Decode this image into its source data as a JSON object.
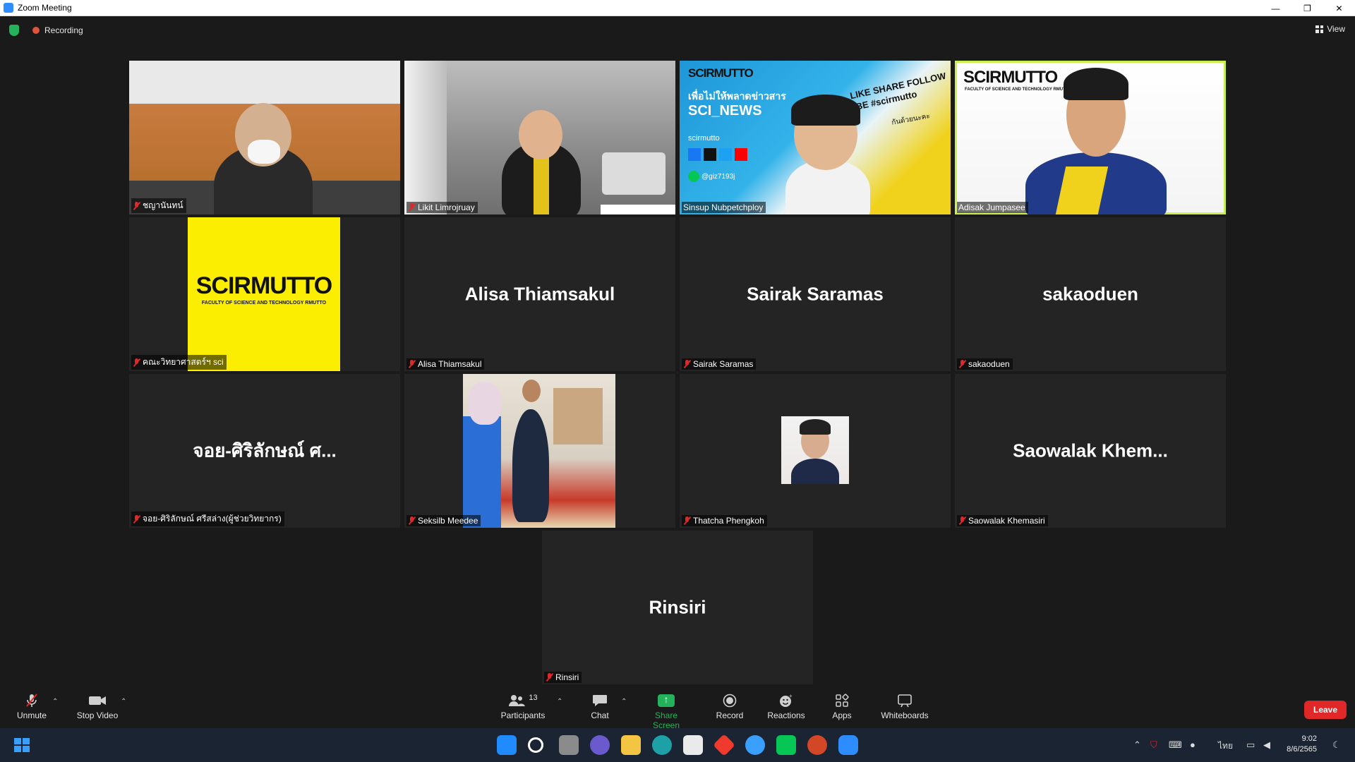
{
  "window": {
    "title": "Zoom Meeting",
    "controls": {
      "minimize": "—",
      "restore": "❐",
      "close": "✕"
    }
  },
  "topbar": {
    "recording_label": "Recording",
    "view_label": "View"
  },
  "participants": [
    {
      "name": "ชญานันทน์",
      "muted": true,
      "type": "video"
    },
    {
      "name": "Likit Limrojruay",
      "muted": true,
      "type": "video"
    },
    {
      "name": "Sinsup Nubpetchploy",
      "muted": false,
      "type": "video"
    },
    {
      "name": "Adisak Jumpasee",
      "muted": false,
      "type": "video",
      "active_speaker": true
    },
    {
      "name": "คณะวิทยาศาสตร์ฯ sci",
      "muted": true,
      "type": "image"
    },
    {
      "name": "Alisa Thiamsakul",
      "display": "Alisa Thiamsakul",
      "muted": true,
      "type": "name"
    },
    {
      "name": "Sairak Saramas",
      "display": "Sairak Saramas",
      "muted": true,
      "type": "name"
    },
    {
      "name": "sakaoduen",
      "display": "sakaoduen",
      "muted": true,
      "type": "name"
    },
    {
      "name": "จอย-ศิริลักษณ์ ศรีสล่าง(ผู้ช่วยวิทยากร)",
      "display": "จอย-ศิริลักษณ์ ศ...",
      "muted": true,
      "type": "name"
    },
    {
      "name": "Seksilb Meedee",
      "muted": true,
      "type": "image"
    },
    {
      "name": "Thatcha Phengkoh",
      "muted": true,
      "type": "avatar"
    },
    {
      "name": "Saowalak Khemasiri",
      "display": "Saowalak Khem...",
      "muted": true,
      "type": "name"
    },
    {
      "name": "Rinsiri",
      "display": "Rinsiri",
      "muted": true,
      "type": "name"
    }
  ],
  "video_content": {
    "brand": "SCIRMUTTO",
    "brand_sub": "FACULTY OF SCIENCE AND TECHNOLOGY RMUTTO",
    "news_thai": "เพื่อไม่ให้พลาดข่าวสาร",
    "news_title": "SCI_NEWS",
    "handle": "scirmutto",
    "line_id": "@giz7193j",
    "slogan": "LIKE SHARE FOLLOW",
    "slogan2": "RIBE #scirmutto",
    "slogan_thai": "กันด้วยนะคะ"
  },
  "toolbar": {
    "unmute_label": "Unmute",
    "stop_video_label": "Stop Video",
    "participants_label": "Participants",
    "participants_count": "13",
    "chat_label": "Chat",
    "share_screen_label": "Share Screen",
    "record_label": "Record",
    "reactions_label": "Reactions",
    "apps_label": "Apps",
    "whiteboards_label": "Whiteboards",
    "leave_label": "Leave"
  },
  "taskbar": {
    "language": "ไทย",
    "time": "9:02",
    "date": "8/6/2565"
  },
  "colors": {
    "accent_green": "#24b35a",
    "muted_red": "#e02828",
    "active_speaker": "#c9f04b",
    "leave_red": "#e02828"
  }
}
